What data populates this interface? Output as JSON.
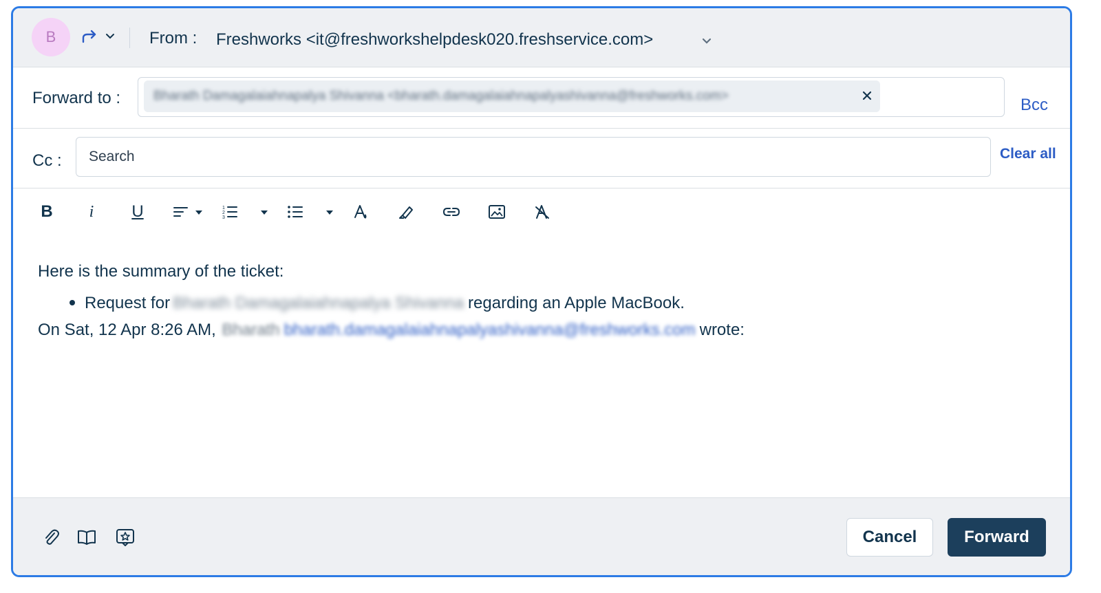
{
  "header": {
    "avatar_initial": "B",
    "from_label": "From :",
    "from_value": "Freshworks <it@freshworkshelpdesk020.freshservice.com>"
  },
  "forward": {
    "label": "Forward to :",
    "recipient_chip": "Bharath Damagalaiahnapalya Shivanna <bharath.damagalaiahnapalyashivanna@freshworks.com>",
    "bcc_label": "Bcc"
  },
  "cc": {
    "label": "Cc :",
    "placeholder": "Search",
    "clear_all_label": "Clear all"
  },
  "toolbar": {
    "bold": "B",
    "italic": "i",
    "underline": "U"
  },
  "editor": {
    "line1": "Here is the summary of the ticket:",
    "bullet_prefix": "Request for",
    "bullet_name": "Bharath Damagalaiahnapalya Shivanna",
    "bullet_suffix": "regarding an Apple MacBook.",
    "quote_prefix": "On Sat, 12 Apr 8:26 AM,",
    "quote_sender": "Bharath",
    "quote_email": "bharath.damagalaiahnapalyashivanna@freshworks.com",
    "quote_suffix": "wrote:"
  },
  "footer": {
    "cancel_label": "Cancel",
    "forward_label": "Forward"
  },
  "colors": {
    "accent_border": "#2c7be5",
    "link": "#2c5cc5",
    "primary_button": "#1c3f5c",
    "avatar_bg": "#f5d3f7"
  }
}
